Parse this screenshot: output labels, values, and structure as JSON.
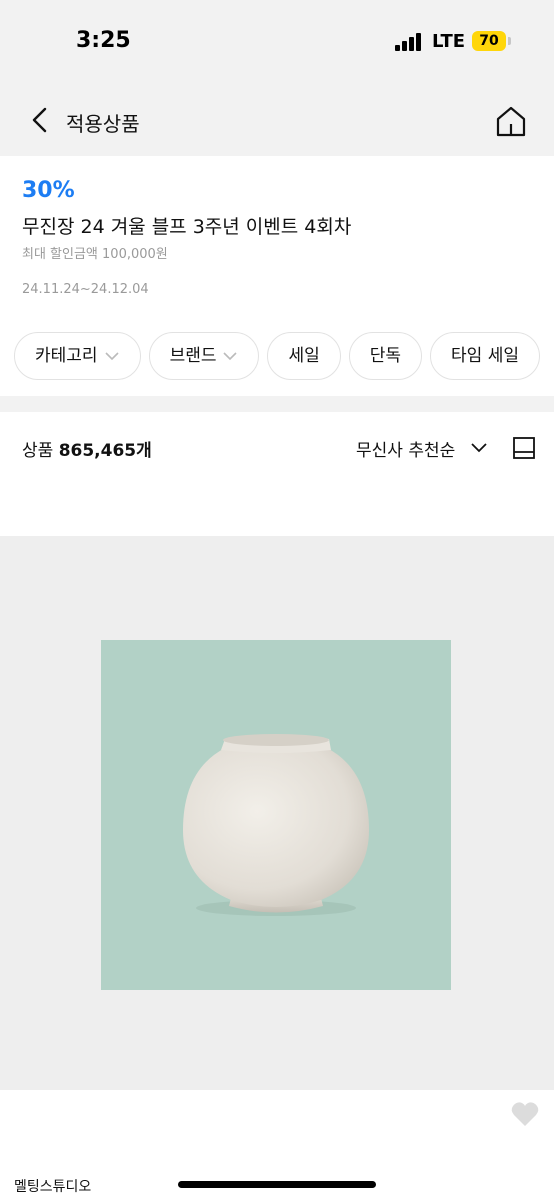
{
  "status_bar": {
    "time": "3:25",
    "network": "LTE",
    "battery": "70"
  },
  "nav": {
    "title": "적용상품",
    "back_icon": "chevron-left-icon",
    "home_icon": "home-icon"
  },
  "promo": {
    "rate": "30%",
    "title": "무진장 24 겨울 블프 3주년 이벤트 4회차",
    "max_discount": "최대 할인금액 100,000원",
    "period": "24.11.24~24.12.04",
    "accent_color": "#1d7df3"
  },
  "filters": [
    {
      "label": "카테고리",
      "has_dropdown": true
    },
    {
      "label": "브랜드",
      "has_dropdown": true
    },
    {
      "label": "세일",
      "has_dropdown": false
    },
    {
      "label": "단독",
      "has_dropdown": false
    },
    {
      "label": "타임 세일",
      "has_dropdown": false
    }
  ],
  "list": {
    "count_label": "상품",
    "count_value": "865,465개",
    "sort_label": "무신사 추천순",
    "view_icon": "single-view-icon"
  },
  "product": {
    "brand": "멜팅스튜디오",
    "image_background": "#b2d1c6",
    "wishlist_icon": "heart-icon"
  }
}
